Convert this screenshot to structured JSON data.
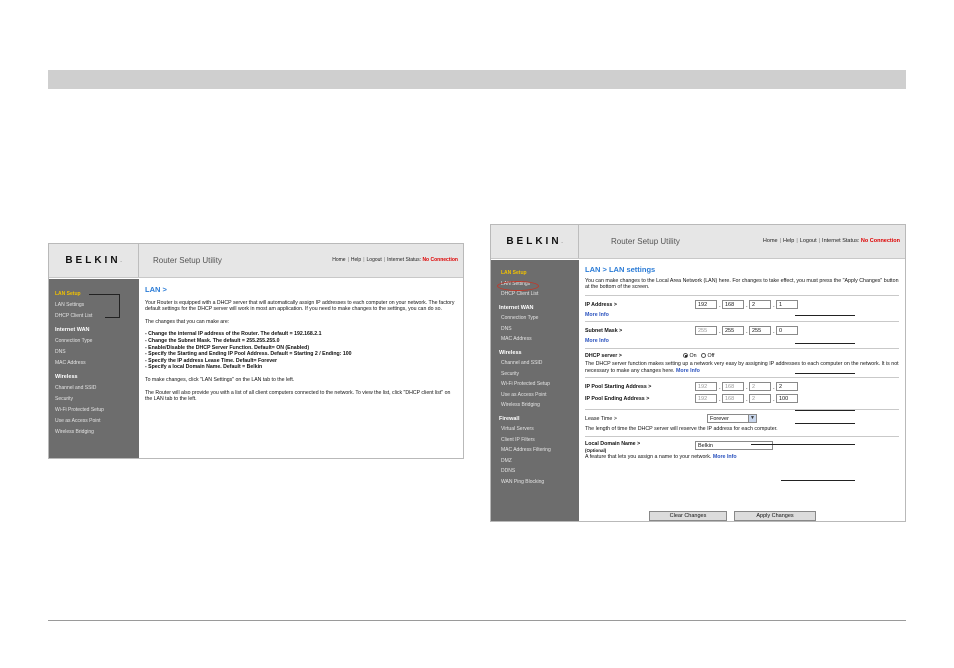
{
  "brand": {
    "logo": "BELKIN",
    "utility": "Router Setup Utility"
  },
  "top_links": {
    "home": "Home",
    "help": "Help",
    "logout": "Logout",
    "sep": "|",
    "status_label": "Internet Status:",
    "status_value": "No Connection"
  },
  "shot1": {
    "sidebar": {
      "lan_setup": "LAN Setup",
      "lan_settings": "LAN Settings",
      "dhcp_client_list": "DHCP Client List",
      "internet_wan": "Internet WAN",
      "connection_type": "Connection Type",
      "dns": "DNS",
      "mac_address": "MAC Address",
      "wireless": "Wireless",
      "channel_ssid": "Channel and SSID",
      "security": "Security",
      "wps": "Wi-Fi Protected Setup",
      "use_as_ap": "Use as Access Point",
      "wireless_bridging": "Wireless Bridging"
    },
    "title": "LAN >",
    "intro": "Your Router is equipped with a DHCP server that will automatically assign IP addresses to each computer on your network. The factory default settings for the DHCP server will work in most am application. If you need to make changes to the settings, you can do so.",
    "changes_heading": "The changes that you can make are:",
    "changes": [
      "- Change the internal IP address of the Router. The default = 192.168.2.1",
      "- Change the Subnet Mask. The default = 255.255.255.0",
      "- Enable/Disable the DHCP Server Function. Default= ON (Enabled)",
      "- Specify the Starting and Ending IP Pool Address. Default = Starting 2 / Ending: 100",
      "- Specify the IP address Lease Time. Default= Forever",
      "- Specify a local Domain Name. Default = Belkin"
    ],
    "to_make": "To make changes, click \"LAN Settings\" on the LAN tab to the left.",
    "client_list": "The Router will also provide you with a list of all client computers connected to the network. To view the list, click \"DHCP client list\" on the LAN tab to the left."
  },
  "shot2": {
    "sidebar": {
      "lan_setup": "LAN Setup",
      "lan_settings": "LAN Settings",
      "dhcp_client_list": "DHCP Client List",
      "internet_wan": "Internet WAN",
      "connection_type": "Connection Type",
      "dns": "DNS",
      "mac_address": "MAC Address",
      "wireless": "Wireless",
      "channel_ssid": "Channel and SSID",
      "security": "Security",
      "wps": "Wi-Fi Protected Setup",
      "use_as_ap": "Use as Access Point",
      "wireless_bridging": "Wireless Bridging",
      "firewall": "Firewall",
      "virtual_servers": "Virtual Servers",
      "client_ip_filters": "Client IP Filters",
      "mac_filtering": "MAC Address Filtering",
      "dmz": "DMZ",
      "ddns": "DDNS",
      "wan_ping": "WAN Ping Blocking"
    },
    "title": "LAN > LAN settings",
    "intro": "You can make changes to the Local Area Network (LAN) here. For changes to take effect, you must press the \"Apply Changes\" button at the bottom of the screen.",
    "ip_label": "IP Address >",
    "ip": [
      "192",
      "168",
      "2",
      "1"
    ],
    "more_info": "More Info",
    "subnet_label": "Subnet Mask >",
    "subnet": [
      "255",
      "255",
      "255",
      "0"
    ],
    "dhcp_label": "DHCP server >",
    "dhcp_on": "On",
    "dhcp_off": "Off",
    "dhcp_desc": "The DHCP server function makes setting up a network very easy by assigning IP addresses to each computer on the network. It is not necessary to make any changes here.",
    "pool_start_label": "IP Pool Starting Address >",
    "pool_start": [
      "192",
      "168",
      "2",
      "2"
    ],
    "pool_end_label": "IP Pool Ending Address >",
    "pool_end": [
      "192",
      "168",
      "2",
      "100"
    ],
    "lease_label": "Lease Time >",
    "lease_value": "Forever",
    "lease_desc": "The length of time the DHCP server will reserve the IP address for each computer.",
    "domain_label": "Local Domain Name >",
    "domain_optional": "(Optional)",
    "domain_value": "Belkin",
    "domain_desc": "A feature that lets you assign a name to your network.",
    "clear_button": "Clear Changes",
    "apply_button": "Apply Changes"
  }
}
